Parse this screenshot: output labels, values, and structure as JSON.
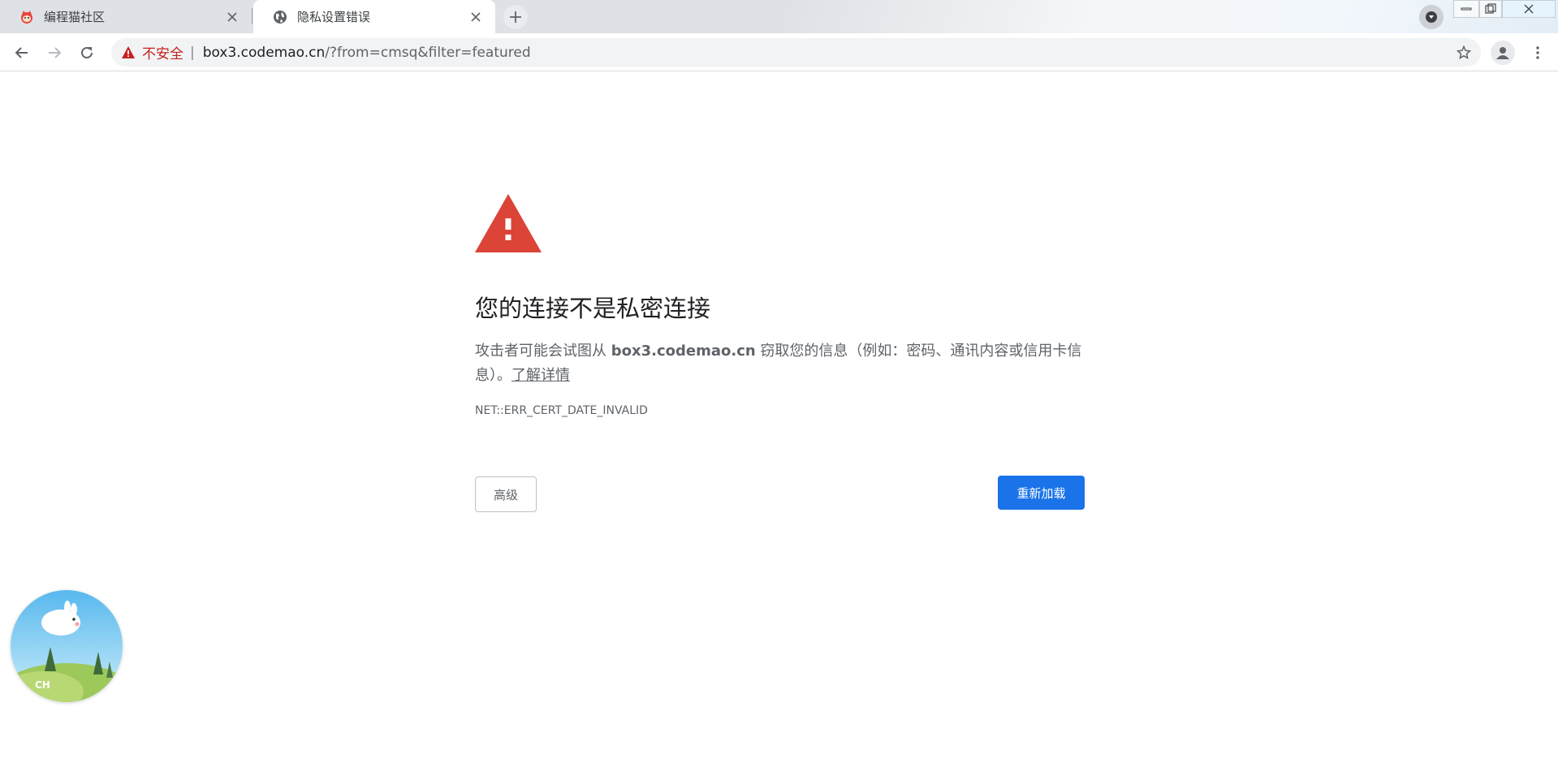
{
  "tabs": [
    {
      "title": "编程猫社区",
      "favicon": "codemao-cat-icon",
      "active": false
    },
    {
      "title": "隐私设置错误",
      "favicon": "globe-icon",
      "active": true
    }
  ],
  "toolbar": {
    "security_label": "不安全",
    "url_host": "box3.codemao.cn",
    "url_path": "/?from=cmsq&filter=featured"
  },
  "interstitial": {
    "heading": "您的连接不是私密连接",
    "message_prefix": "攻击者可能会试图从 ",
    "message_host": "box3.codemao.cn",
    "message_suffix": " 窃取您的信息（例如：密码、通讯内容或信用卡信息）。",
    "learn_more": "了解详情",
    "error_code": "NET::ERR_CERT_DATE_INVALID",
    "advanced_button": "高级",
    "reload_button": "重新加载"
  },
  "widget": {
    "label": "CH"
  },
  "colors": {
    "alert_red": "#db4437",
    "insecure_red": "#c5221f",
    "primary_blue": "#1a73e8",
    "tabstrip_bg": "#dee1e6"
  }
}
